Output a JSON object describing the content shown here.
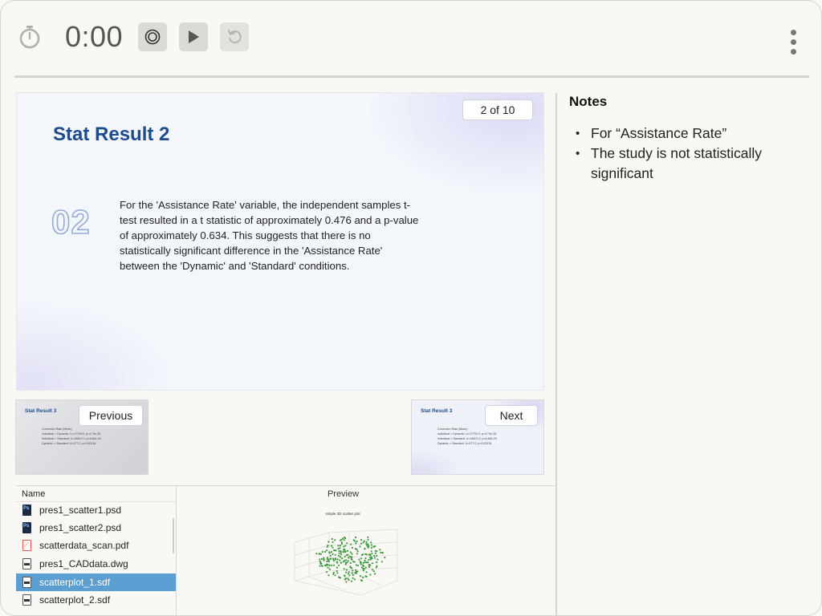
{
  "toolbar": {
    "timer": "0:00",
    "icons": [
      "stopwatch-icon",
      "record-icon",
      "play-icon",
      "reset-icon",
      "kebab-menu-icon"
    ]
  },
  "slide": {
    "page_indicator": "2 of 10",
    "title": "Stat Result 2",
    "number": "02",
    "body": "For the 'Assistance Rate' variable, the independent samples t-test resulted in a t statistic of approximately 0.476 and a p-value of approximately 0.634. This suggests that there is no statistically significant difference in the 'Assistance Rate' between the 'Dynamic' and 'Standard' conditions."
  },
  "thumbnails": {
    "previous": {
      "button_label": "Previous",
      "title": "Stat Result 3",
      "lines": [
        "Correction Rate (Mean)",
        "Individual > Dynamic: U=17700.0, p=4.73e-28",
        "Individual > Standard: U=18407.0, p=6.84e-29",
        "Dynamic > Standard: U=977.0, p=0.00134"
      ]
    },
    "next": {
      "button_label": "Next",
      "title": "Stat Result 3",
      "lines": [
        "Correction Rate (Mean)",
        "Individual > Dynamic: U=17700.0, p=4.73e-28",
        "Individual > Standard: U=18407.0, p=6.84e-29",
        "Dynamic > Standard: U=977.0, p=0.00134"
      ]
    }
  },
  "file_browser": {
    "column_header": "Name",
    "files": [
      {
        "name": "pres1_scatter1.psd",
        "icon": "psd-file-icon",
        "selected": false
      },
      {
        "name": "pres1_scatter2.psd",
        "icon": "psd-file-icon",
        "selected": false
      },
      {
        "name": "scatterdata_scan.pdf",
        "icon": "pdf-file-icon",
        "selected": false
      },
      {
        "name": "pres1_CADdata.dwg",
        "icon": "document-file-icon",
        "selected": false
      },
      {
        "name": "scatterplot_1.sdf",
        "icon": "document-file-icon",
        "selected": true
      },
      {
        "name": "scatterplot_2.sdf",
        "icon": "document-file-icon",
        "selected": false
      }
    ],
    "preview_header": "Preview",
    "preview_title": "simple 3D scatter plot"
  },
  "notes": {
    "title": "Notes",
    "items": [
      "For “Assistance Rate”",
      "The study is not statistically significant"
    ]
  }
}
